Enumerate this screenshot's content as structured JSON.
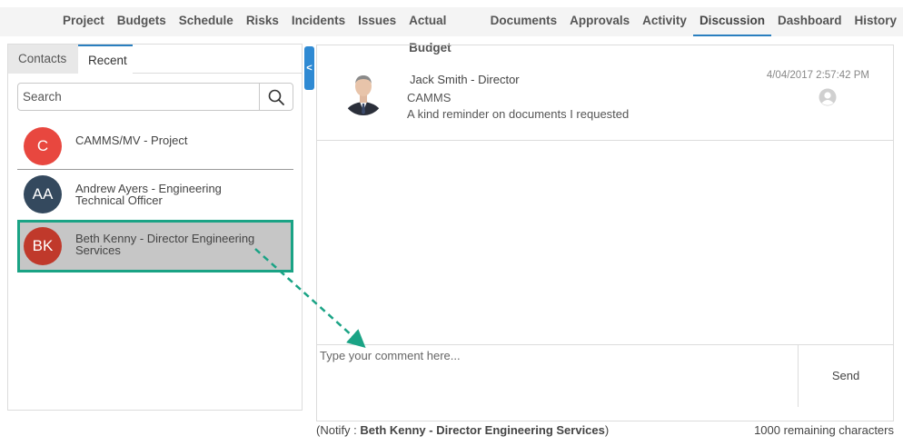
{
  "nav": {
    "tabs": [
      {
        "label": "Project"
      },
      {
        "label": "Budgets"
      },
      {
        "label": "Schedule"
      },
      {
        "label": "Risks"
      },
      {
        "label": "Incidents"
      },
      {
        "label": "Issues"
      },
      {
        "label": "Actual Budget"
      },
      {
        "label": "Documents"
      },
      {
        "label": "Approvals"
      },
      {
        "label": "Activity"
      },
      {
        "label": "Discussion",
        "active": true
      },
      {
        "label": "Dashboard"
      },
      {
        "label": "History"
      }
    ]
  },
  "left_panel": {
    "tabs": {
      "contacts": "Contacts",
      "recent": "Recent"
    },
    "active_tab": "Recent",
    "search": {
      "placeholder": "Search",
      "icon": "search-icon"
    },
    "contacts": [
      {
        "initials": "C",
        "name": "CAMMS/MV - Project",
        "color": "#e8473f"
      },
      {
        "initials": "AA",
        "name_line1": "Andrew Ayers - Engineering",
        "name_line2": "Technical Officer",
        "color": "#34495e"
      },
      {
        "initials": "BK",
        "name_line1": "Beth Kenny - Director Engineering",
        "name_line2": "Services",
        "color": "#c0392b",
        "selected": true
      }
    ],
    "collapse_label": "<"
  },
  "message": {
    "author": "Jack Smith - Director",
    "org": "CAMMS",
    "text": "A kind reminder on documents I requested",
    "timestamp": "4/04/2017 2:57:42 PM",
    "icon": "user-icon"
  },
  "composer": {
    "placeholder": "Type your comment here...",
    "send_label": "Send"
  },
  "footer": {
    "notify_prefix": "(Notify : ",
    "notify_name": "Beth Kenny - Director Engineering Services",
    "notify_suffix": ")",
    "remaining": "1000 remaining characters"
  },
  "colors": {
    "accent": "#2a7fbf",
    "highlight": "#1aa385",
    "collapse_tab": "#2f8ad3"
  }
}
